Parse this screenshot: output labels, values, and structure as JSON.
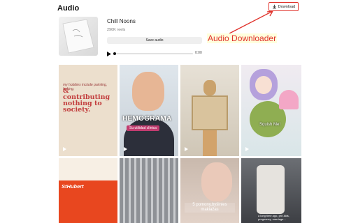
{
  "header": {
    "title": "Audio",
    "download_label": "Download"
  },
  "audio": {
    "track_name": "Chill Noons",
    "reels_count": "290K reels",
    "save_label": "Save audio",
    "time": "0:00"
  },
  "annotation": {
    "label": "Audio Downloader",
    "color": "#e0322b"
  },
  "tiles": [
    {
      "line1": "my hobbies include painting, baking,",
      "line2": "& contributing nothing to society."
    },
    {
      "line1": "HEMOGRAMA",
      "line2": "Su utilidad clínica"
    },
    {},
    {
      "line1": "Squish Me!"
    },
    {
      "line1": "StHubert"
    },
    {},
    {
      "line1": "5 pomony,byšinies makiažas"
    },
    {
      "line1": "a long time ago, pre-kids, pregnancy, marriage..."
    }
  ]
}
